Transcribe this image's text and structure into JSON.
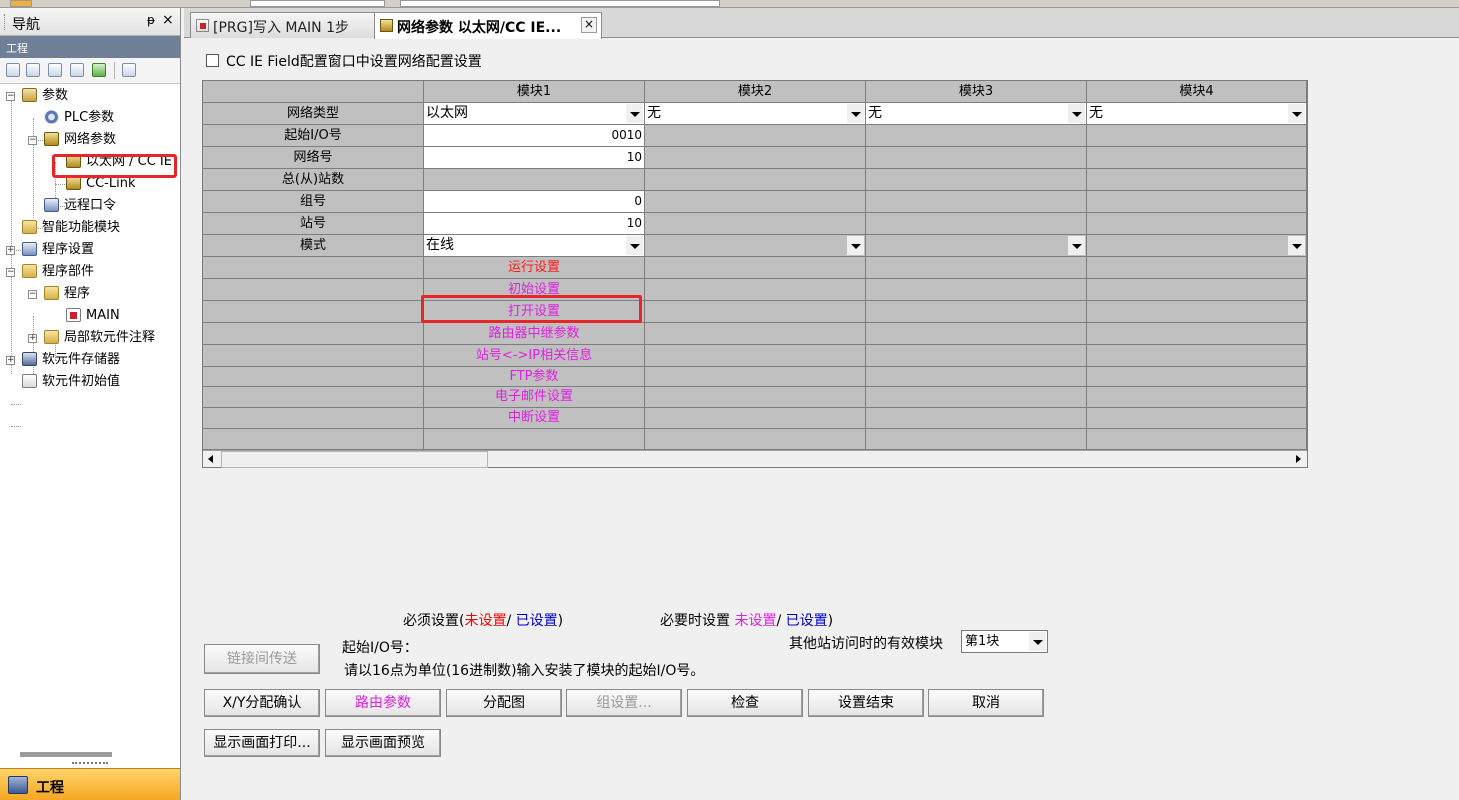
{
  "nav": {
    "title": "导航",
    "pin": "ᵽ",
    "close": "×",
    "section": "工程",
    "bottom_label": "工程",
    "tree": [
      {
        "label": "参数"
      },
      {
        "label": "PLC参数"
      },
      {
        "label": "网络参数"
      },
      {
        "label": "以太网 / CC IE"
      },
      {
        "label": "CC-Link"
      },
      {
        "label": "远程口令"
      },
      {
        "label": "智能功能模块"
      },
      {
        "label": "程序设置"
      },
      {
        "label": "程序部件"
      },
      {
        "label": "程序"
      },
      {
        "label": "MAIN"
      },
      {
        "label": "局部软元件注释"
      },
      {
        "label": "软元件存储器"
      },
      {
        "label": "软元件初始值"
      }
    ]
  },
  "tabs": [
    {
      "label": "[PRG]写入 MAIN 1步"
    },
    {
      "label": "网络参数 以太网/CC IE..."
    }
  ],
  "main": {
    "cc_ie_checkbox": {
      "label": "CC IE Field配置窗口中设置网络配置设置",
      "checked": false
    },
    "columns": [
      "模块1",
      "模块2",
      "模块3",
      "模块4"
    ],
    "rows": {
      "network_type": "网络类型",
      "start_io": "起始I/O号",
      "network_no": "网络号",
      "total_stations": "总(从)站数",
      "group_no": "组号",
      "station_no": "站号",
      "mode": "模式"
    },
    "module1": {
      "network_type": "以太网",
      "start_io": "0010",
      "network_no": "10",
      "group_no": "0",
      "station_no": "10",
      "mode": "在线"
    },
    "other_network_type": "无",
    "links": [
      {
        "label": "运行设置",
        "state": "unset"
      },
      {
        "label": "初始设置",
        "state": "optional"
      },
      {
        "label": "打开设置",
        "state": "optional"
      },
      {
        "label": "路由器中继参数",
        "state": "optional"
      },
      {
        "label": "站号<->IP相关信息",
        "state": "optional"
      },
      {
        "label": "FTP参数",
        "state": "optional"
      },
      {
        "label": "电子邮件设置",
        "state": "optional"
      },
      {
        "label": "中断设置",
        "state": "optional"
      }
    ],
    "legend": {
      "required_prefix": "必须设置(",
      "required_unset": "未设置",
      "sep1": "/",
      "required_set": "已设置",
      "required_suffix": ")",
      "optional_prefix": "必要时设置",
      "optional_unset": "未设置",
      "sep2": "/",
      "optional_set": "已设置",
      "optional_suffix": ")"
    },
    "effective_module": {
      "label": "其他站访问时的有效模块",
      "value": "第1块"
    },
    "hint_title": "起始I/O号：",
    "hint_text": "请以16点为单位(16进制数)输入安装了模块的起始I/O号。",
    "buttons": {
      "link_transfer": "链接间传送",
      "xy_confirm": "X/Y分配确认",
      "routing": "路由参数",
      "assignment": "分配图",
      "group": "组设置...",
      "check": "检查",
      "finish": "设置结束",
      "cancel": "取消",
      "print": "显示画面打印...",
      "preview": "显示画面预览"
    }
  },
  "colors": {
    "highlight": "#e8262a",
    "unset_required": "#ff0000",
    "optional": "#e020e0",
    "set": "#0000cc",
    "nav_bottom": "#f5a623"
  }
}
